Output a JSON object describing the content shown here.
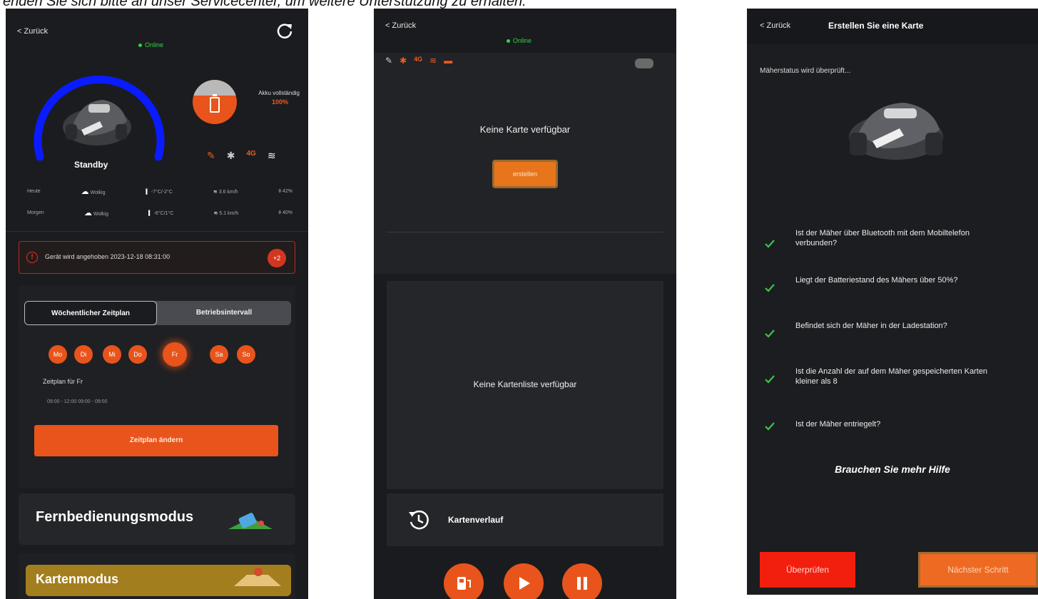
{
  "caption": "enden Sie sich bitte an unser Servicecenter, um weitere Unterstützung zu erhalten.",
  "colors": {
    "accent": "#e8541b",
    "online": "#35d04a",
    "gauge": "#0a1bff",
    "alert_border": "#b9281c",
    "map_mode": "#a37e1e"
  },
  "screen1": {
    "back": "< Zurück",
    "online": "Online",
    "state": "Standby",
    "battery_label": "Akku vollständig",
    "battery_value": "100%",
    "battery_fill": 1.0,
    "weather": [
      {
        "day": "Heute",
        "cond": "Wolkig",
        "temp": "-7°C/-2°C",
        "wind": "3.6 km/h",
        "humidity": "42%"
      },
      {
        "day": "Morgen",
        "cond": "Wolkig",
        "temp": "-6°C/1°C",
        "wind": "5.1 km/h",
        "humidity": "40%"
      }
    ],
    "alert_text": "Gerät wird angehoben  2023-12-18 08:31:00",
    "alert_badge": "+2",
    "tab_weekly": "Wöchentlicher Zeitplan",
    "tab_interval": "Betriebsintervall",
    "days": [
      "Mo",
      "Di",
      "Mi",
      "Do",
      "Fr",
      "Sa",
      "So"
    ],
    "selected_day": "Fr",
    "schedule_title": "Zeitplan für Fr",
    "schedule_times": "09:00 - 12:00      09:00 - 09:00",
    "change_button": "Zeitplan ändern",
    "remote_mode": "Fernbedienungsmodus",
    "map_mode": "Kartenmodus"
  },
  "screen2": {
    "back": "< Zurück",
    "online": "Online",
    "no_map": "Keine Karte verfügbar",
    "create_button": "erstellen",
    "no_map_list": "Keine Kartenliste verfügbar",
    "map_history": "Kartenverlauf"
  },
  "screen3": {
    "back": "< Zurück",
    "title": "Erstellen Sie eine Karte",
    "status": "Mäherstatus wird überprüft...",
    "checks": [
      "Ist der Mäher über Bluetooth mit dem Mobiltelefon verbunden?",
      "Liegt der Batteriestand des Mähers über 50%?",
      "Befindet sich der Mäher in der Ladestation?",
      "Ist die Anzahl der auf dem Mäher gespeicherten Karten kleiner als 8",
      "Ist der Mäher entriegelt?"
    ],
    "help": "Brauchen Sie mehr Hilfe",
    "check_button": "Überprüfen",
    "next_button": "Nächster Schritt"
  }
}
